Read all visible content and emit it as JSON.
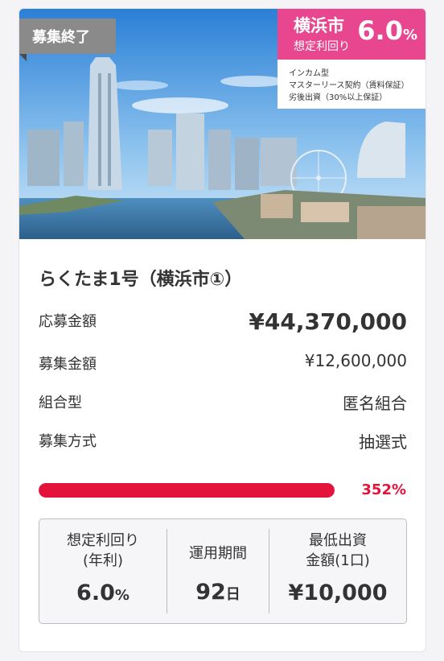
{
  "listing": {
    "status": "募集終了",
    "city": "横浜市",
    "yield_label": "想定利回り",
    "yield_value": "6.0",
    "yield_unit": "%",
    "features": [
      "インカム型",
      "マスターリース契約（賃料保証）",
      "劣後出資（30%以上保証）"
    ],
    "title": "らくたま1号（横浜市①）",
    "details": [
      {
        "label": "応募金額",
        "value": "¥44,370,000"
      },
      {
        "label": "募集金額",
        "value": "¥12,600,000"
      },
      {
        "label": "組合型",
        "value": "匿名組合"
      },
      {
        "label": "募集方式",
        "value": "抽選式"
      }
    ],
    "progress": {
      "percent_text": "352%",
      "fill_fraction": 1.0
    },
    "stats": {
      "yield_heading_1": "想定利回り",
      "yield_heading_2": "(年利)",
      "yield_value": "6.0",
      "yield_unit": "%",
      "term_heading": "運用期間",
      "term_value": "92",
      "term_unit": "日",
      "min_heading_1": "最低出資",
      "min_heading_2": "金額(1口)",
      "min_value": "¥10,000"
    }
  },
  "colors": {
    "accent_pink": "#e8478f",
    "progress_red": "#e3133b",
    "badge_gray": "#8a8a8a"
  }
}
